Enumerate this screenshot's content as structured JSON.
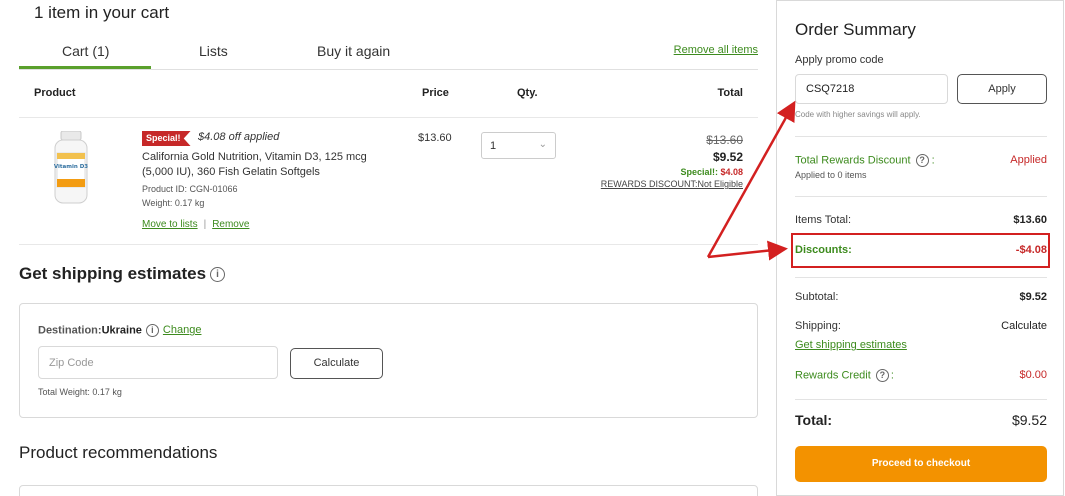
{
  "cart": {
    "title": "1 item in your cart",
    "tabs": [
      {
        "label": "Cart (1)"
      },
      {
        "label": "Lists"
      },
      {
        "label": "Buy it again"
      }
    ],
    "remove_all": "Remove all items",
    "columns": {
      "product": "Product",
      "price": "Price",
      "qty": "Qty.",
      "total": "Total"
    },
    "item": {
      "badge": "Special!",
      "off_applied": "$4.08 off applied",
      "name": "California Gold Nutrition, Vitamin D3, 125 mcg (5,000 IU), 360 Fish Gelatin Softgels",
      "product_id": "Product ID: CGN-01066",
      "weight": "Weight: 0.17 kg",
      "move_to_lists": "Move to lists",
      "separator": "|",
      "remove": "Remove",
      "price": "$13.60",
      "qty": "1",
      "total_original": "$13.60",
      "total_new": "$9.52",
      "special_label": "Special!:",
      "special_value": "$4.08",
      "rewards_discount": "REWARDS DISCOUNT:Not Eligible",
      "image_label": "Vitamin D3"
    }
  },
  "shipping": {
    "title": "Get shipping estimates",
    "destination_label": "Destination:",
    "destination_value": "Ukraine",
    "change": "Change",
    "zip_placeholder": "Zip Code",
    "calculate": "Calculate",
    "total_weight": "Total Weight: 0.17 kg"
  },
  "recommendations": {
    "title": "Product recommendations"
  },
  "summary": {
    "title": "Order Summary",
    "promo_label": "Apply promo code",
    "promo_value": "CSQ7218",
    "apply": "Apply",
    "promo_note": "Code with higher savings will apply.",
    "total_rewards_discount": {
      "label": "Total Rewards Discount",
      "value": "Applied",
      "sub": "Applied to 0 items"
    },
    "items_total": {
      "label": "Items Total:",
      "value": "$13.60"
    },
    "discounts": {
      "label": "Discounts:",
      "value": "-$4.08"
    },
    "subtotal": {
      "label": "Subtotal:",
      "value": "$9.52"
    },
    "shipping": {
      "label": "Shipping:",
      "value": "Calculate",
      "link": "Get shipping estimates"
    },
    "rewards_credit": {
      "label": "Rewards Credit",
      "colon": ":",
      "value": "$0.00"
    },
    "total": {
      "label": "Total:",
      "value": "$9.52"
    },
    "checkout": "Proceed to checkout"
  },
  "colors": {
    "accent_green": "#3d8b1e",
    "price_red": "#c62828",
    "checkout_orange": "#f39200",
    "annotation_red": "#d32020"
  },
  "icons": [
    "info-icon",
    "chevron-down-icon",
    "annotation-arrow"
  ]
}
